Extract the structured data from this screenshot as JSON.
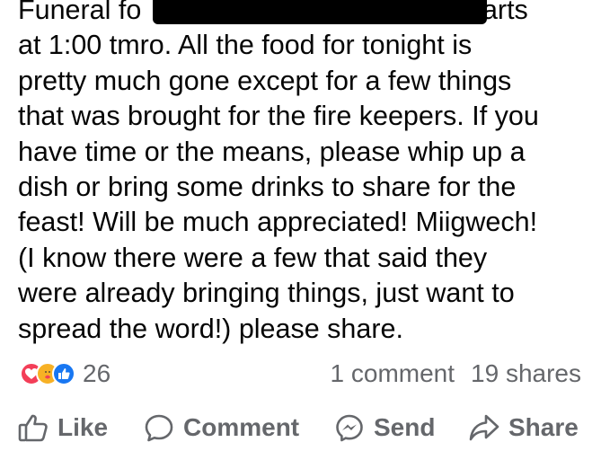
{
  "post": {
    "lines": [
      "Funeral fo                                          starts",
      "at 1:00 tmro. All the food for tonight is",
      "pretty much gone except for a few things",
      "that was brought for the fire keepers. If you",
      "have time or the means, please whip up a",
      "dish or bring some drinks to share for the",
      "feast! Will be much appreciated! Miigwech!",
      "(I know there were a few that said they",
      "were already bringing things, just want to",
      "spread the word!) please share."
    ]
  },
  "stats": {
    "reaction_icons": [
      "love-reaction-icon",
      "care-reaction-icon",
      "like-reaction-icon"
    ],
    "reaction_count": "26",
    "comments": "1 comment",
    "shares": "19 shares"
  },
  "actions": {
    "like": "Like",
    "comment": "Comment",
    "send": "Send",
    "share": "Share"
  },
  "colors": {
    "text": "#050505",
    "secondary": "#65676b",
    "love": "#f33e58",
    "care": "#f7b125",
    "like": "#1877f2"
  }
}
